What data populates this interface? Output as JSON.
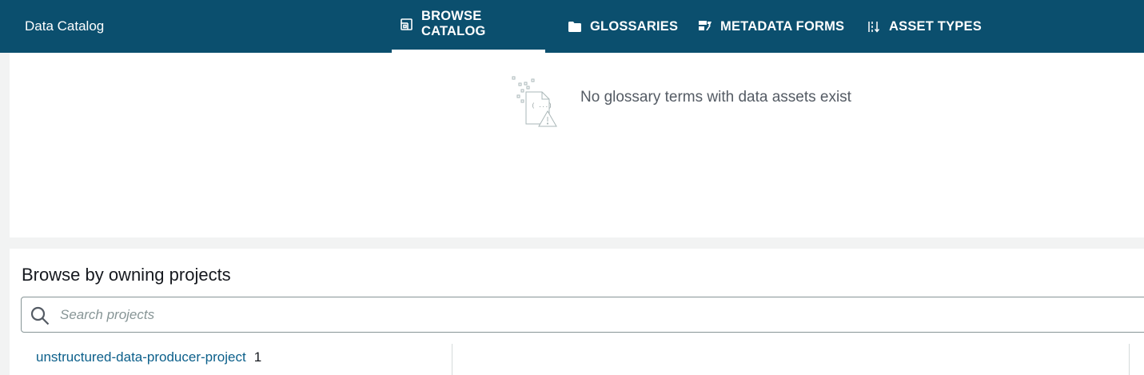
{
  "header": {
    "app_title": "Data Catalog",
    "tabs": [
      {
        "label": "BROWSE CATALOG",
        "icon": "browse-catalog-icon",
        "active": true
      },
      {
        "label": "GLOSSARIES",
        "icon": "folder-icon",
        "active": false
      },
      {
        "label": "METADATA FORMS",
        "icon": "metadata-forms-icon",
        "active": false
      },
      {
        "label": "ASSET TYPES",
        "icon": "asset-types-icon",
        "active": false
      }
    ]
  },
  "glossary_panel": {
    "empty_icon": "empty-document-warning-icon",
    "empty_message": "No glossary terms with data assets exist"
  },
  "projects_panel": {
    "title": "Browse by owning projects",
    "search": {
      "placeholder": "Search projects",
      "value": ""
    },
    "projects": [
      {
        "name": "unstructured-data-producer-project",
        "count": "1"
      }
    ]
  },
  "colors": {
    "header_bg": "#0b4f6e",
    "link": "#0b5f8a",
    "page_bg": "#f2f3f3"
  }
}
